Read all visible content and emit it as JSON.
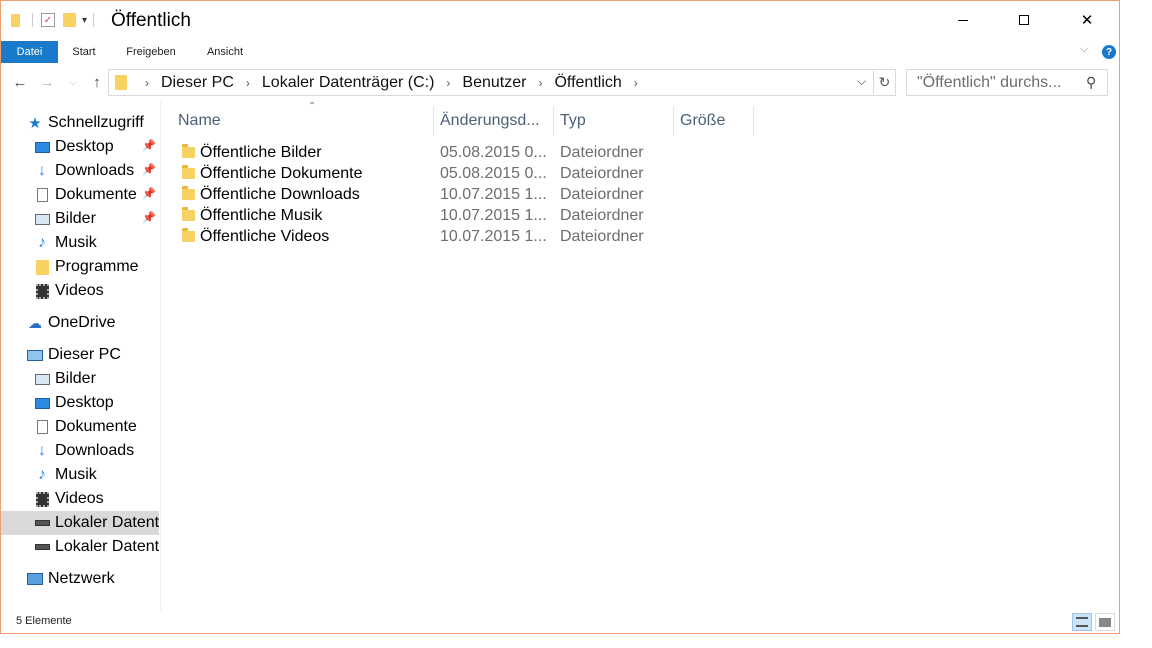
{
  "window": {
    "title": "Öffentlich"
  },
  "ribbon": {
    "tabs": [
      {
        "label": "Datei"
      },
      {
        "label": "Start"
      },
      {
        "label": "Freigeben"
      },
      {
        "label": "Ansicht"
      }
    ]
  },
  "address": {
    "breadcrumb": [
      "Dieser PC",
      "Lokaler Datenträger (C:)",
      "Benutzer",
      "Öffentlich"
    ]
  },
  "search": {
    "placeholder": "\"Öffentlich\" durchs..."
  },
  "navigation": {
    "quick_access": {
      "label": "Schnellzugriff",
      "items": [
        {
          "label": "Desktop",
          "icon": "desktop-icon",
          "pinned": true
        },
        {
          "label": "Downloads",
          "icon": "downloads-icon",
          "pinned": true
        },
        {
          "label": "Dokumente",
          "icon": "documents-icon",
          "pinned": true
        },
        {
          "label": "Bilder",
          "icon": "pictures-icon",
          "pinned": true
        },
        {
          "label": "Musik",
          "icon": "music-icon",
          "pinned": false
        },
        {
          "label": "Programme",
          "icon": "folder-icon",
          "pinned": false
        },
        {
          "label": "Videos",
          "icon": "videos-icon",
          "pinned": false
        }
      ]
    },
    "onedrive": {
      "label": "OneDrive"
    },
    "this_pc": {
      "label": "Dieser PC",
      "items": [
        {
          "label": "Bilder",
          "icon": "pictures-icon"
        },
        {
          "label": "Desktop",
          "icon": "desktop-icon"
        },
        {
          "label": "Dokumente",
          "icon": "documents-icon"
        },
        {
          "label": "Downloads",
          "icon": "downloads-icon"
        },
        {
          "label": "Musik",
          "icon": "music-icon"
        },
        {
          "label": "Videos",
          "icon": "videos-icon"
        },
        {
          "label": "Lokaler Datenträger (C:)",
          "icon": "drive-icon",
          "selected": true
        },
        {
          "label": "Lokaler Datenträger",
          "icon": "drive-icon",
          "selected": false
        }
      ]
    },
    "network": {
      "label": "Netzwerk"
    }
  },
  "file_list": {
    "columns": [
      {
        "label": "Name"
      },
      {
        "label": "Änderungsd..."
      },
      {
        "label": "Typ"
      },
      {
        "label": "Größe"
      }
    ],
    "rows": [
      {
        "name": "Öffentliche Bilder",
        "modified": "05.08.2015 0...",
        "type": "Dateiordner",
        "size": ""
      },
      {
        "name": "Öffentliche Dokumente",
        "modified": "05.08.2015 0...",
        "type": "Dateiordner",
        "size": ""
      },
      {
        "name": "Öffentliche Downloads",
        "modified": "10.07.2015 1...",
        "type": "Dateiordner",
        "size": ""
      },
      {
        "name": "Öffentliche Musik",
        "modified": "10.07.2015 1...",
        "type": "Dateiordner",
        "size": ""
      },
      {
        "name": "Öffentliche Videos",
        "modified": "10.07.2015 1...",
        "type": "Dateiordner",
        "size": ""
      }
    ]
  },
  "status": {
    "item_count": "5 Elemente"
  },
  "colors": {
    "accent": "#1979ca",
    "window_border": "#f0a070",
    "column_header_text": "#4c607a",
    "selected_nav": "#d9d9d9",
    "folder": "#f7d162"
  }
}
